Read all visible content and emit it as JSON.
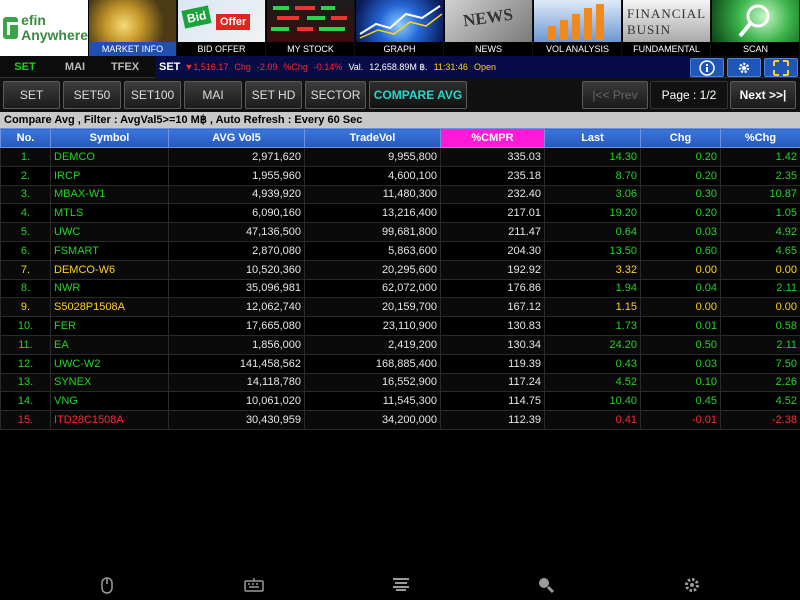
{
  "logo": {
    "line1": "efin",
    "line2": "Anywhere"
  },
  "nav_tiles": [
    {
      "label": "MARKET INFO",
      "active": true
    },
    {
      "label": "BID OFFER",
      "active": false
    },
    {
      "label": "MY STOCK",
      "active": false
    },
    {
      "label": "GRAPH",
      "active": false
    },
    {
      "label": "NEWS",
      "active": false
    },
    {
      "label": "VOL ANALYSIS",
      "active": false
    },
    {
      "label": "FUNDAMENTAL",
      "active": false
    },
    {
      "label": "SCAN",
      "active": false
    }
  ],
  "nav_tile_texts": {
    "bid": "Bid",
    "offer": "Offer",
    "news": "NEWS",
    "fundamental": "FINANCIAL BUSIN"
  },
  "market_tabs": [
    {
      "label": "SET",
      "active": true
    },
    {
      "label": "MAI",
      "active": false
    },
    {
      "label": "TFEX",
      "active": false
    }
  ],
  "ticker": {
    "name": "SET",
    "index": "1,516.17",
    "chg_label": "Chg",
    "chg": "-2.09",
    "pchg_label": "%Chg",
    "pchg": "-0.14%",
    "val_label": "Val.",
    "val": "12,658.89M ฿.",
    "time": "11:31:46",
    "status": "Open"
  },
  "category_tabs": [
    "SET",
    "SET50",
    "SET100",
    "MAI",
    "SET HD",
    "SECTOR",
    "COMPARE AVG"
  ],
  "active_category": "COMPARE AVG",
  "pager": {
    "prev": "|<< Prev",
    "page": "Page : 1/2",
    "next": "Next >>|"
  },
  "filter_text": "Compare Avg , Filter : AvgVal5>=10 M฿ , Auto Refresh : Every 60 Sec",
  "table": {
    "headers": [
      "No.",
      "Symbol",
      "AVG Vol5",
      "TradeVol",
      "%CMPR",
      "Last",
      "Chg",
      "%Chg"
    ],
    "rows": [
      {
        "no": "1.",
        "symbol": "DEMCO",
        "avg": "2,971,620",
        "vol": "9,955,800",
        "cmpr": "335.03",
        "last": "14.30",
        "chg": "0.20",
        "pchg": "1.42",
        "trend": "up"
      },
      {
        "no": "2.",
        "symbol": "IRCP",
        "avg": "1,955,960",
        "vol": "4,600,100",
        "cmpr": "235.18",
        "last": "8.70",
        "chg": "0.20",
        "pchg": "2.35",
        "trend": "up"
      },
      {
        "no": "3.",
        "symbol": "MBAX-W1",
        "avg": "4,939,920",
        "vol": "11,480,300",
        "cmpr": "232.40",
        "last": "3.06",
        "chg": "0.30",
        "pchg": "10.87",
        "trend": "up"
      },
      {
        "no": "4.",
        "symbol": "MTLS",
        "avg": "6,090,160",
        "vol": "13,216,400",
        "cmpr": "217.01",
        "last": "19.20",
        "chg": "0.20",
        "pchg": "1.05",
        "trend": "up"
      },
      {
        "no": "5.",
        "symbol": "UWC",
        "avg": "47,136,500",
        "vol": "99,681,800",
        "cmpr": "211.47",
        "last": "0.64",
        "chg": "0.03",
        "pchg": "4.92",
        "trend": "up"
      },
      {
        "no": "6.",
        "symbol": "FSMART",
        "avg": "2,870,080",
        "vol": "5,863,600",
        "cmpr": "204.30",
        "last": "13.50",
        "chg": "0.60",
        "pchg": "4.65",
        "trend": "up"
      },
      {
        "no": "7.",
        "symbol": "DEMCO-W6",
        "avg": "10,520,360",
        "vol": "20,295,600",
        "cmpr": "192.92",
        "last": "3.32",
        "chg": "0.00",
        "pchg": "0.00",
        "trend": "nc"
      },
      {
        "no": "8.",
        "symbol": "NWR",
        "avg": "35,096,981",
        "vol": "62,072,000",
        "cmpr": "176.86",
        "last": "1.94",
        "chg": "0.04",
        "pchg": "2.11",
        "trend": "up"
      },
      {
        "no": "9.",
        "symbol": "S5028P1508A",
        "avg": "12,062,740",
        "vol": "20,159,700",
        "cmpr": "167.12",
        "last": "1.15",
        "chg": "0.00",
        "pchg": "0.00",
        "trend": "nc"
      },
      {
        "no": "10.",
        "symbol": "FER",
        "avg": "17,665,080",
        "vol": "23,110,900",
        "cmpr": "130.83",
        "last": "1.73",
        "chg": "0.01",
        "pchg": "0.58",
        "trend": "up"
      },
      {
        "no": "11.",
        "symbol": "EA",
        "avg": "1,856,000",
        "vol": "2,419,200",
        "cmpr": "130.34",
        "last": "24.20",
        "chg": "0.50",
        "pchg": "2.11",
        "trend": "up"
      },
      {
        "no": "12.",
        "symbol": "UWC-W2",
        "avg": "141,458,562",
        "vol": "168,885,400",
        "cmpr": "119.39",
        "last": "0.43",
        "chg": "0.03",
        "pchg": "7.50",
        "trend": "up"
      },
      {
        "no": "13.",
        "symbol": "SYNEX",
        "avg": "14,118,780",
        "vol": "16,552,900",
        "cmpr": "117.24",
        "last": "4.52",
        "chg": "0.10",
        "pchg": "2.26",
        "trend": "up"
      },
      {
        "no": "14.",
        "symbol": "VNG",
        "avg": "10,061,020",
        "vol": "11,545,300",
        "cmpr": "114.75",
        "last": "10.40",
        "chg": "0.45",
        "pchg": "4.52",
        "trend": "up"
      },
      {
        "no": "15.",
        "symbol": "ITD28C1508A",
        "avg": "30,430,959",
        "vol": "34,200,000",
        "cmpr": "112.39",
        "last": "0.41",
        "chg": "-0.01",
        "pchg": "-2.38",
        "trend": "dn"
      }
    ]
  },
  "colors": {
    "up": "#22d422",
    "unchanged": "#ffd21a",
    "down": "#ff2828",
    "header_blue": "#2f66cc",
    "highlight_header": "#ff1ad9",
    "active_tab_text": "#27d7c7"
  },
  "toolbar_icons": [
    "info-icon",
    "gear-icon",
    "fullscreen-icon"
  ],
  "bottom_icons": [
    "mouse-icon",
    "keyboard-icon",
    "menu-icon",
    "search-icon",
    "settings-icon"
  ]
}
